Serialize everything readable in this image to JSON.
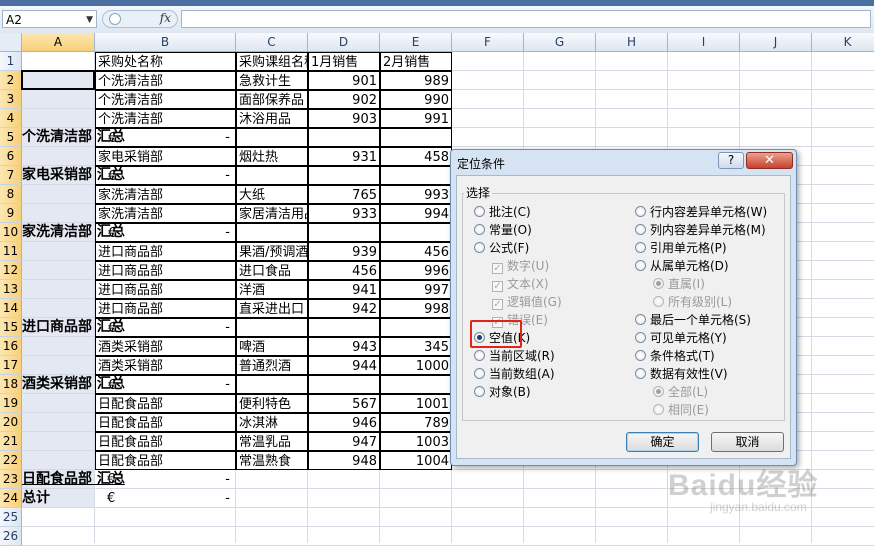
{
  "formula_bar": {
    "name_box": "A2",
    "fx_label": "fx",
    "formula": ""
  },
  "columns": [
    "A",
    "B",
    "C",
    "D",
    "E",
    "F",
    "G",
    "H",
    "I",
    "J",
    "K"
  ],
  "rows": [
    "1",
    "2",
    "3",
    "4",
    "5",
    "6",
    "7",
    "8",
    "9",
    "10",
    "11",
    "12",
    "13",
    "14",
    "15",
    "16",
    "17",
    "18",
    "19",
    "20",
    "21",
    "22",
    "23",
    "24",
    "25",
    "26"
  ],
  "headers": {
    "b": "采购处名称",
    "c": "采购课组名称",
    "d": "1月销售",
    "e": "2月销售"
  },
  "detail_rows": [
    {
      "row": 2,
      "b": "个洗清洁部",
      "c": "急救计生",
      "d": "901",
      "e": "989"
    },
    {
      "row": 3,
      "b": "个洗清洁部",
      "c": "面部保养品",
      "d": "902",
      "e": "990"
    },
    {
      "row": 4,
      "b": "个洗清洁部",
      "c": "沐浴用品",
      "d": "903",
      "e": "991"
    },
    {
      "row": 6,
      "b": "家电采销部",
      "c": "烟灶热",
      "d": "931",
      "e": "458"
    },
    {
      "row": 8,
      "b": "家洗清洁部",
      "c": "大纸",
      "d": "765",
      "e": "993"
    },
    {
      "row": 9,
      "b": "家洗清洁部",
      "c": "家居清洁用品",
      "d": "933",
      "e": "994"
    },
    {
      "row": 11,
      "b": "进口商品部",
      "c": "果酒/预调酒",
      "d": "939",
      "e": "456"
    },
    {
      "row": 12,
      "b": "进口商品部",
      "c": "进口食品",
      "d": "456",
      "e": "996"
    },
    {
      "row": 13,
      "b": "进口商品部",
      "c": "洋酒",
      "d": "941",
      "e": "997"
    },
    {
      "row": 14,
      "b": "进口商品部",
      "c": "直采进出口",
      "d": "942",
      "e": "998"
    },
    {
      "row": 16,
      "b": "酒类采销部",
      "c": "啤酒",
      "d": "943",
      "e": "345"
    },
    {
      "row": 17,
      "b": "酒类采销部",
      "c": "普通烈酒",
      "d": "944",
      "e": "1000"
    },
    {
      "row": 19,
      "b": "日配食品部",
      "c": "便利特色",
      "d": "567",
      "e": "1001"
    },
    {
      "row": 20,
      "b": "日配食品部",
      "c": "冰淇淋",
      "d": "946",
      "e": "789"
    },
    {
      "row": 21,
      "b": "日配食品部",
      "c": "常温乳品",
      "d": "947",
      "e": "1003"
    },
    {
      "row": 22,
      "b": "日配食品部",
      "c": "常温熟食",
      "d": "948",
      "e": "1004"
    }
  ],
  "subtotal_rows": [
    {
      "row": 5,
      "a": "个洗清洁部 汇总",
      "euro": "€",
      "dash": "-"
    },
    {
      "row": 7,
      "a": "家电采销部 汇总",
      "euro": "€",
      "dash": "-"
    },
    {
      "row": 10,
      "a": "家洗清洁部 汇总",
      "euro": "€",
      "dash": "-"
    },
    {
      "row": 15,
      "a": "进口商品部 汇总",
      "euro": "€",
      "dash": "-"
    },
    {
      "row": 18,
      "a": "酒类采销部 汇总",
      "euro": "€",
      "dash": "-"
    },
    {
      "row": 23,
      "a": "日配食品部 汇总",
      "euro": "€",
      "dash": "-"
    },
    {
      "row": 24,
      "a": "总计",
      "euro": "€",
      "dash": "-"
    }
  ],
  "dialog": {
    "title": "定位条件",
    "help_label": "?",
    "close_label": "✕",
    "group_label": "选择",
    "left_options": [
      {
        "label": "批注(C)",
        "kind": "radio",
        "checked": false,
        "disabled": false
      },
      {
        "label": "常量(O)",
        "kind": "radio",
        "checked": false,
        "disabled": false
      },
      {
        "label": "公式(F)",
        "kind": "radio",
        "checked": false,
        "disabled": false
      },
      {
        "label": "数字(U)",
        "kind": "check",
        "checked": true,
        "disabled": true
      },
      {
        "label": "文本(X)",
        "kind": "check",
        "checked": true,
        "disabled": true
      },
      {
        "label": "逻辑值(G)",
        "kind": "check",
        "checked": true,
        "disabled": true
      },
      {
        "label": "错误(E)",
        "kind": "check",
        "checked": true,
        "disabled": true
      },
      {
        "label": "空值(K)",
        "kind": "radio",
        "checked": true,
        "disabled": false
      },
      {
        "label": "当前区域(R)",
        "kind": "radio",
        "checked": false,
        "disabled": false
      },
      {
        "label": "当前数组(A)",
        "kind": "radio",
        "checked": false,
        "disabled": false
      },
      {
        "label": "对象(B)",
        "kind": "radio",
        "checked": false,
        "disabled": false
      }
    ],
    "right_options": [
      {
        "label": "行内容差异单元格(W)",
        "kind": "radio",
        "checked": false,
        "disabled": false
      },
      {
        "label": "列内容差异单元格(M)",
        "kind": "radio",
        "checked": false,
        "disabled": false
      },
      {
        "label": "引用单元格(P)",
        "kind": "radio",
        "checked": false,
        "disabled": false
      },
      {
        "label": "从属单元格(D)",
        "kind": "radio",
        "checked": false,
        "disabled": false
      },
      {
        "label": "直属(I)",
        "kind": "radio",
        "checked": true,
        "disabled": true
      },
      {
        "label": "所有级别(L)",
        "kind": "radio",
        "checked": false,
        "disabled": true
      },
      {
        "label": "最后一个单元格(S)",
        "kind": "radio",
        "checked": false,
        "disabled": false
      },
      {
        "label": "可见单元格(Y)",
        "kind": "radio",
        "checked": false,
        "disabled": false
      },
      {
        "label": "条件格式(T)",
        "kind": "radio",
        "checked": false,
        "disabled": false
      },
      {
        "label": "数据有效性(V)",
        "kind": "radio",
        "checked": false,
        "disabled": false
      },
      {
        "label": "全部(L)",
        "kind": "radio",
        "checked": true,
        "disabled": true
      },
      {
        "label": "相同(E)",
        "kind": "radio",
        "checked": false,
        "disabled": true
      }
    ],
    "ok_label": "确定",
    "cancel_label": "取消"
  },
  "watermark": {
    "main": "Baidu经验",
    "sub": "jingyan.baidu.com"
  },
  "colors": {
    "highlight": "#e3231a",
    "selection": "#f8cf78",
    "grid": "#d4dae3"
  }
}
